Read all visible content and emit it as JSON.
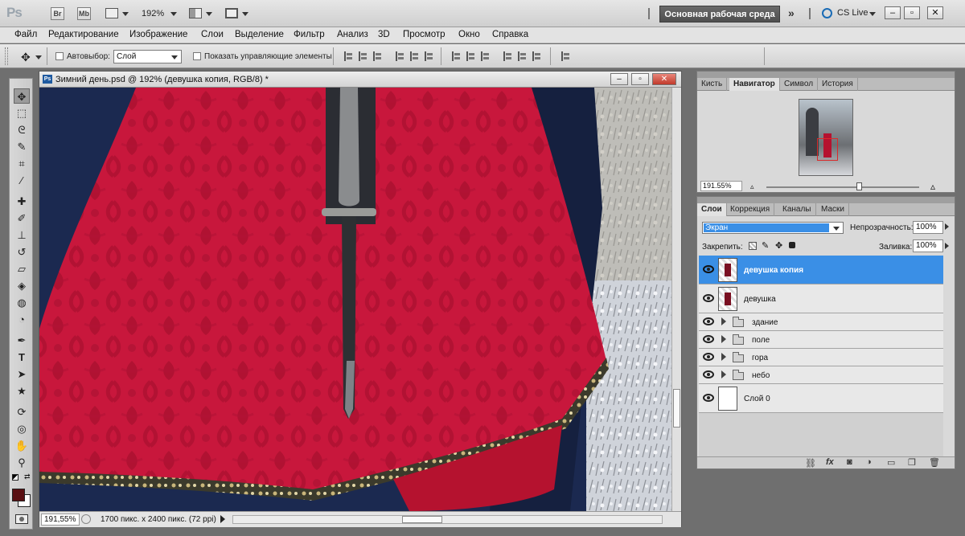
{
  "app": {
    "logo": "Ps",
    "bridge_label": "Br",
    "minibridge_label": "Mb",
    "zoom": "192%",
    "workspace": "Основная рабочая среда",
    "cs_live": "CS Live"
  },
  "menu": [
    "Файл",
    "Редактирование",
    "Изображение",
    "Слои",
    "Выделение",
    "Фильтр",
    "Анализ",
    "3D",
    "Просмотр",
    "Окно",
    "Справка"
  ],
  "options": {
    "auto_select_label": "Автовыбор:",
    "auto_select_value": "Слой",
    "show_controls_label": "Показать управляющие элементы"
  },
  "document": {
    "title": "Зимний день.psd @ 192% (девушка копия, RGB/8) *",
    "status_zoom": "191,55%",
    "status_info": "1700 пикс. x 2400 пикс. (72 ppi)"
  },
  "navigator": {
    "tabs": [
      "Кисть",
      "Навигатор",
      "Символ",
      "История"
    ],
    "active_tab": 1,
    "zoom": "191.55%"
  },
  "layers_panel": {
    "tabs": [
      "Слои",
      "Коррекция",
      "Каналы",
      "Маски"
    ],
    "active_tab": 0,
    "blend_mode": "Экран",
    "opacity_label": "Непрозрачность:",
    "opacity_value": "100%",
    "lock_label": "Закрепить:",
    "fill_label": "Заливка:",
    "fill_value": "100%",
    "layers": [
      {
        "name": "девушка копия",
        "kind": "image",
        "selected": true
      },
      {
        "name": "девушка",
        "kind": "image",
        "selected": false
      },
      {
        "name": "здание",
        "kind": "group",
        "selected": false
      },
      {
        "name": "поле",
        "kind": "group",
        "selected": false
      },
      {
        "name": "гора",
        "kind": "group",
        "selected": false
      },
      {
        "name": "небо",
        "kind": "group",
        "selected": false
      },
      {
        "name": "Слой 0",
        "kind": "background",
        "selected": false
      }
    ]
  },
  "colors": {
    "foreground": "#5a0f12",
    "background": "#ffffff",
    "selection": "#3a8fe6"
  }
}
